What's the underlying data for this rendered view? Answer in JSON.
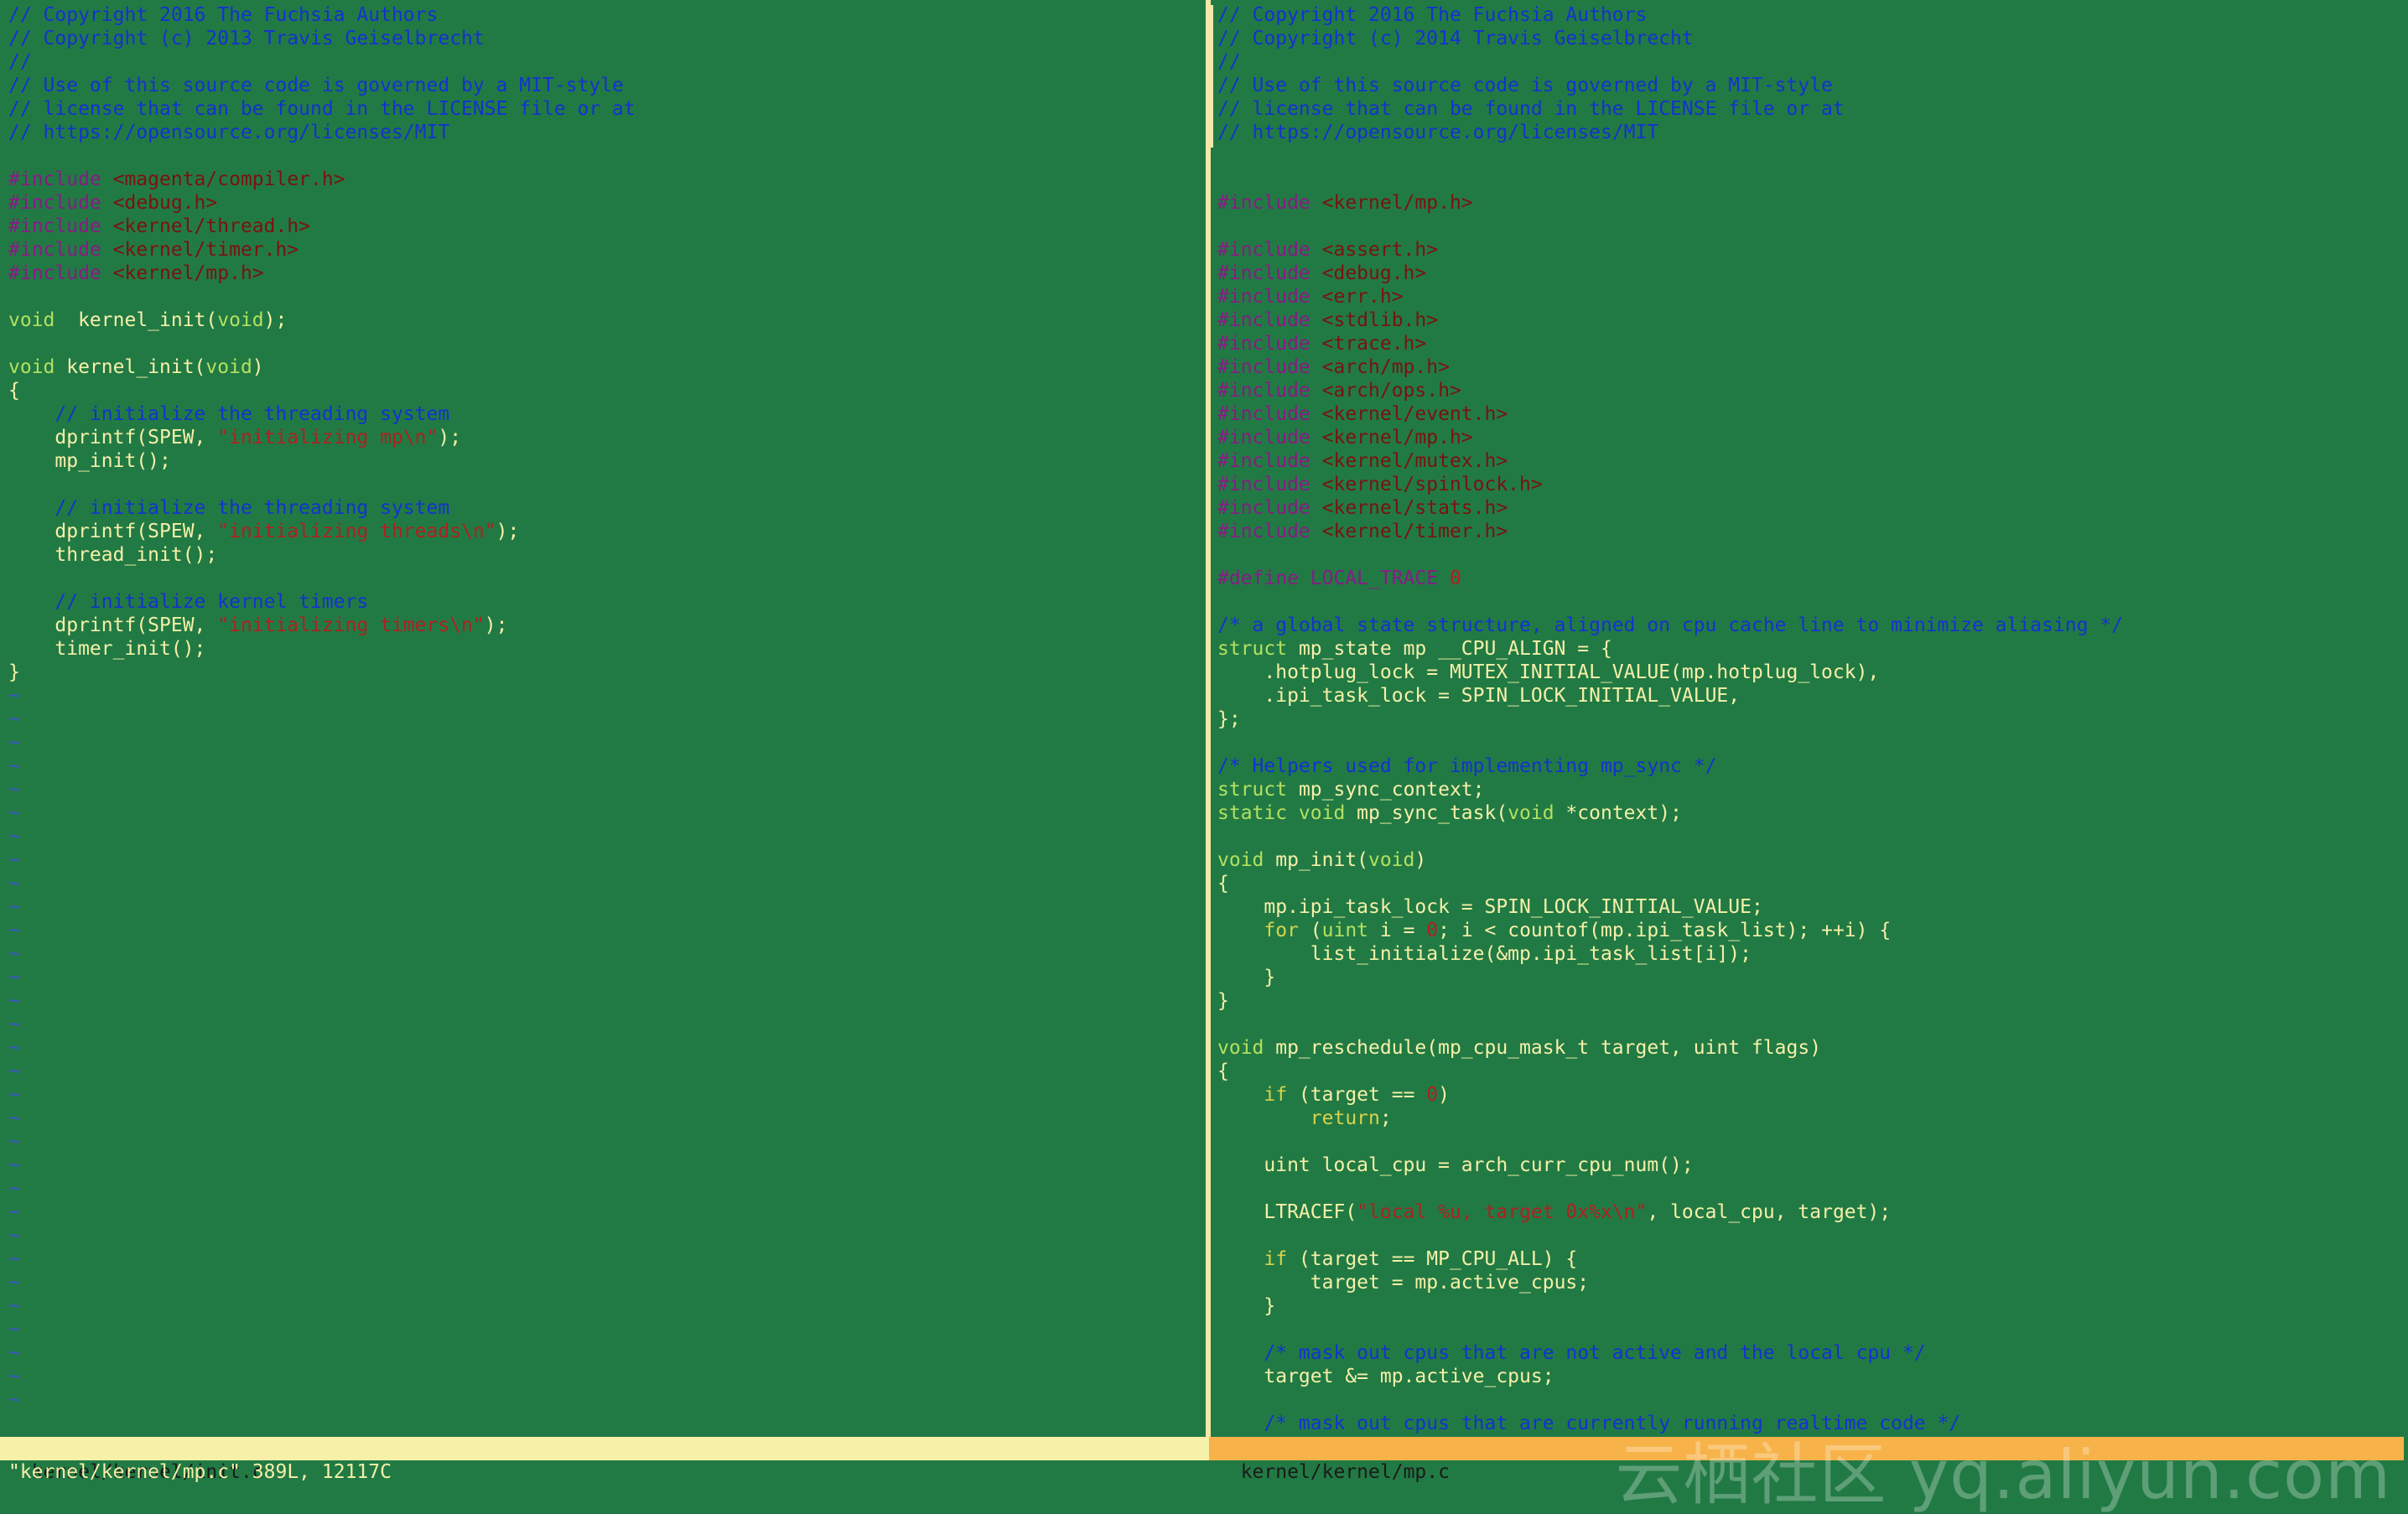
{
  "left_file": {
    "lines": [
      {
        "class": "cm",
        "text": "// Copyright 2016 The Fuchsia Authors"
      },
      {
        "class": "cm",
        "text": "// Copyright (c) 2013 Travis Geiselbrecht"
      },
      {
        "class": "cm",
        "text": "//"
      },
      {
        "class": "cm",
        "text": "// Use of this source code is governed by a MIT-style"
      },
      {
        "class": "cm",
        "text": "// license that can be found in the LICENSE file or at"
      },
      {
        "class": "cm",
        "text": "// https://opensource.org/licenses/MIT"
      },
      {
        "class": "",
        "text": ""
      },
      {
        "segs": [
          [
            "pp",
            "#include "
          ],
          [
            "inc",
            "<magenta/compiler.h>"
          ]
        ]
      },
      {
        "segs": [
          [
            "pp",
            "#include "
          ],
          [
            "inc",
            "<debug.h>"
          ]
        ]
      },
      {
        "segs": [
          [
            "pp",
            "#include "
          ],
          [
            "inc",
            "<kernel/thread.h>"
          ]
        ]
      },
      {
        "segs": [
          [
            "pp",
            "#include "
          ],
          [
            "inc",
            "<kernel/timer.h>"
          ]
        ]
      },
      {
        "segs": [
          [
            "pp",
            "#include "
          ],
          [
            "inc",
            "<kernel/mp.h>"
          ]
        ]
      },
      {
        "class": "",
        "text": ""
      },
      {
        "segs": [
          [
            "ty",
            "void"
          ],
          [
            "",
            "  kernel_init("
          ],
          [
            "ty",
            "void"
          ],
          [
            "",
            ");"
          ]
        ]
      },
      {
        "class": "",
        "text": ""
      },
      {
        "segs": [
          [
            "ty",
            "void"
          ],
          [
            "",
            " kernel_init("
          ],
          [
            "ty",
            "void"
          ],
          [
            "",
            ")"
          ]
        ]
      },
      {
        "class": "",
        "text": "{"
      },
      {
        "segs": [
          [
            "cm",
            "    // initialize the threading system"
          ]
        ]
      },
      {
        "segs": [
          [
            "",
            "    dprintf(SPEW, "
          ],
          [
            "str",
            "\"initializing mp"
          ],
          [
            "esc",
            "\\n"
          ],
          [
            "str",
            "\""
          ],
          [
            "",
            ");"
          ]
        ]
      },
      {
        "class": "",
        "text": "    mp_init();"
      },
      {
        "class": "",
        "text": ""
      },
      {
        "segs": [
          [
            "cm",
            "    // initialize the threading system"
          ]
        ]
      },
      {
        "segs": [
          [
            "",
            "    dprintf(SPEW, "
          ],
          [
            "str",
            "\"initializing threads"
          ],
          [
            "esc",
            "\\n"
          ],
          [
            "str",
            "\""
          ],
          [
            "",
            ");"
          ]
        ]
      },
      {
        "class": "",
        "text": "    thread_init();"
      },
      {
        "class": "",
        "text": ""
      },
      {
        "segs": [
          [
            "cm",
            "    // initialize kernel timers"
          ]
        ]
      },
      {
        "segs": [
          [
            "",
            "    dprintf(SPEW, "
          ],
          [
            "str",
            "\"initializing timers"
          ],
          [
            "esc",
            "\\n"
          ],
          [
            "str",
            "\""
          ],
          [
            "",
            ");"
          ]
        ]
      },
      {
        "class": "",
        "text": "    timer_init();"
      },
      {
        "class": "",
        "text": "}"
      }
    ],
    "tilde_count": 31,
    "tilde_char": "~"
  },
  "right_file": {
    "lines": [
      {
        "class": "cm",
        "text": "// Copyright 2016 The Fuchsia Authors"
      },
      {
        "class": "cm",
        "text": "// Copyright (c) 2014 Travis Geiselbrecht"
      },
      {
        "class": "cm",
        "text": "//"
      },
      {
        "class": "cm",
        "text": "// Use of this source code is governed by a MIT-style"
      },
      {
        "class": "cm",
        "text": "// license that can be found in the LICENSE file or at"
      },
      {
        "class": "cm",
        "text": "// https://opensource.org/licenses/MIT"
      },
      {
        "class": "",
        "text": ""
      },
      {
        "class": "",
        "text": ""
      },
      {
        "segs": [
          [
            "pp",
            "#include "
          ],
          [
            "inc",
            "<kernel/mp.h>"
          ]
        ]
      },
      {
        "class": "",
        "text": ""
      },
      {
        "segs": [
          [
            "pp",
            "#include "
          ],
          [
            "inc",
            "<assert.h>"
          ]
        ]
      },
      {
        "segs": [
          [
            "pp",
            "#include "
          ],
          [
            "inc",
            "<debug.h>"
          ]
        ]
      },
      {
        "segs": [
          [
            "pp",
            "#include "
          ],
          [
            "inc",
            "<err.h>"
          ]
        ]
      },
      {
        "segs": [
          [
            "pp",
            "#include "
          ],
          [
            "inc",
            "<stdlib.h>"
          ]
        ]
      },
      {
        "segs": [
          [
            "pp",
            "#include "
          ],
          [
            "inc",
            "<trace.h>"
          ]
        ]
      },
      {
        "segs": [
          [
            "pp",
            "#include "
          ],
          [
            "inc",
            "<arch/mp.h>"
          ]
        ]
      },
      {
        "segs": [
          [
            "pp",
            "#include "
          ],
          [
            "inc",
            "<arch/ops.h>"
          ]
        ]
      },
      {
        "segs": [
          [
            "pp",
            "#include "
          ],
          [
            "inc",
            "<kernel/event.h>"
          ]
        ]
      },
      {
        "segs": [
          [
            "pp",
            "#include "
          ],
          [
            "inc",
            "<kernel/mp.h>"
          ]
        ]
      },
      {
        "segs": [
          [
            "pp",
            "#include "
          ],
          [
            "inc",
            "<kernel/mutex.h>"
          ]
        ]
      },
      {
        "segs": [
          [
            "pp",
            "#include "
          ],
          [
            "inc",
            "<kernel/spinlock.h>"
          ]
        ]
      },
      {
        "segs": [
          [
            "pp",
            "#include "
          ],
          [
            "inc",
            "<kernel/stats.h>"
          ]
        ]
      },
      {
        "segs": [
          [
            "pp",
            "#include "
          ],
          [
            "inc",
            "<kernel/timer.h>"
          ]
        ]
      },
      {
        "class": "",
        "text": ""
      },
      {
        "segs": [
          [
            "pp",
            "#define LOCAL_TRACE "
          ],
          [
            "num",
            "0"
          ]
        ]
      },
      {
        "class": "",
        "text": ""
      },
      {
        "segs": [
          [
            "cm",
            "/* a global state structure, aligned on cpu cache line to minimize aliasing */"
          ]
        ]
      },
      {
        "segs": [
          [
            "ty",
            "struct"
          ],
          [
            "",
            " mp_state mp __CPU_ALIGN = {"
          ]
        ]
      },
      {
        "class": "",
        "text": "    .hotplug_lock = MUTEX_INITIAL_VALUE(mp.hotplug_lock),"
      },
      {
        "class": "",
        "text": "    .ipi_task_lock = SPIN_LOCK_INITIAL_VALUE,"
      },
      {
        "class": "",
        "text": "};"
      },
      {
        "class": "",
        "text": ""
      },
      {
        "segs": [
          [
            "cm",
            "/* Helpers used for implementing mp_sync */"
          ]
        ]
      },
      {
        "segs": [
          [
            "ty",
            "struct"
          ],
          [
            "",
            " mp_sync_context;"
          ]
        ]
      },
      {
        "segs": [
          [
            "ty",
            "static void"
          ],
          [
            "",
            " mp_sync_task("
          ],
          [
            "ty",
            "void"
          ],
          [
            "",
            " *context);"
          ]
        ]
      },
      {
        "class": "",
        "text": ""
      },
      {
        "segs": [
          [
            "ty",
            "void"
          ],
          [
            "",
            " mp_init("
          ],
          [
            "ty",
            "void"
          ],
          [
            "",
            ")"
          ]
        ]
      },
      {
        "class": "",
        "text": "{"
      },
      {
        "class": "",
        "text": "    mp.ipi_task_lock = SPIN_LOCK_INITIAL_VALUE;"
      },
      {
        "segs": [
          [
            "kw",
            "    for"
          ],
          [
            "",
            " ("
          ],
          [
            "ty",
            "uint"
          ],
          [
            "",
            " i = "
          ],
          [
            "num",
            "0"
          ],
          [
            "",
            "; i < countof(mp.ipi_task_list); ++i) {"
          ]
        ]
      },
      {
        "class": "",
        "text": "        list_initialize(&mp.ipi_task_list[i]);"
      },
      {
        "class": "",
        "text": "    }"
      },
      {
        "class": "",
        "text": "}"
      },
      {
        "class": "",
        "text": ""
      },
      {
        "segs": [
          [
            "ty",
            "void"
          ],
          [
            "",
            " mp_reschedule(mp_cpu_mask_t target, uint flags)"
          ]
        ]
      },
      {
        "class": "",
        "text": "{"
      },
      {
        "segs": [
          [
            "kw",
            "    if"
          ],
          [
            "",
            " (target == "
          ],
          [
            "num",
            "0"
          ],
          [
            "",
            ")"
          ]
        ]
      },
      {
        "segs": [
          [
            "kw",
            "        return"
          ],
          [
            "",
            ";"
          ]
        ]
      },
      {
        "class": "",
        "text": ""
      },
      {
        "class": "",
        "text": "    uint local_cpu = arch_curr_cpu_num();"
      },
      {
        "class": "",
        "text": ""
      },
      {
        "segs": [
          [
            "",
            "    LTRACEF("
          ],
          [
            "str",
            "\"local "
          ],
          [
            "esc",
            "%u"
          ],
          [
            "str",
            ", target 0x"
          ],
          [
            "esc",
            "%x\\n"
          ],
          [
            "str",
            "\""
          ],
          [
            "",
            ", local_cpu, target);"
          ]
        ]
      },
      {
        "class": "",
        "text": ""
      },
      {
        "segs": [
          [
            "kw",
            "    if"
          ],
          [
            "",
            " (target == MP_CPU_ALL) {"
          ]
        ]
      },
      {
        "class": "",
        "text": "        target = mp.active_cpus;"
      },
      {
        "class": "",
        "text": "    }"
      },
      {
        "class": "",
        "text": ""
      },
      {
        "segs": [
          [
            "cm",
            "    /* mask out cpus that are not active and the local cpu */"
          ]
        ]
      },
      {
        "class": "",
        "text": "    target &= mp.active_cpus;"
      },
      {
        "class": "",
        "text": ""
      },
      {
        "segs": [
          [
            "cm",
            "    /* mask out cpus that are currently running realtime code */"
          ]
        ]
      }
    ]
  },
  "status": {
    "left_filename": "kernel/kernel/init.c",
    "right_filename": "kernel/kernel/mp.c",
    "cmdline": "\"kernel/kernel/mp.c\" 389L, 12117C"
  },
  "watermark": "云栖社区 yq.aliyun.com",
  "colors": {
    "background": "#217a44",
    "comment": "#1432d0",
    "preprocessor": "#8a1a86",
    "include_path": "#7a1210",
    "type": "#b4e060",
    "keyword": "#d8d24a",
    "string_num": "#b02020",
    "status_inactive": "#f6f0a8",
    "status_active": "#f7b34a"
  }
}
